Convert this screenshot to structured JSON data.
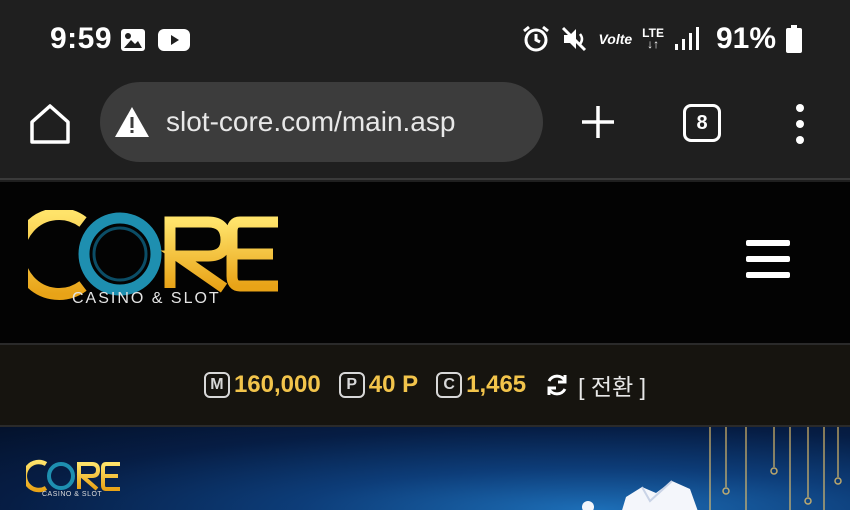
{
  "status_bar": {
    "time": "9:59",
    "battery": "91%",
    "network": "LTE",
    "volte": "Volte",
    "icons": [
      "image-icon",
      "youtube-icon",
      "alarm-icon",
      "mute-icon",
      "volte-icon",
      "lte-icon",
      "signal-icon",
      "battery-icon"
    ]
  },
  "browser": {
    "url": "slot-core.com/main.asp",
    "tab_count": "8",
    "icons": [
      "home-icon",
      "warning-icon",
      "plus-icon",
      "tabs-icon",
      "more-vert-icon"
    ]
  },
  "site": {
    "logo_text": "CORE",
    "logo_subtitle": "CASINO & SLOT",
    "balance": {
      "money_icon": "M",
      "money": "160,000",
      "point_icon": "P",
      "point": "40 P",
      "coin_icon": "C",
      "coin": "1,465",
      "switch_label": "[ 전환 ]"
    },
    "banner": {
      "logo_text": "CORE",
      "logo_subtitle": "CASINO & SLOT"
    }
  },
  "colors": {
    "accent_gold": "#f2c44b",
    "logo_teal": "#1e8fb0",
    "background_dark": "#030303",
    "chrome_bg": "#1f1f1f"
  }
}
